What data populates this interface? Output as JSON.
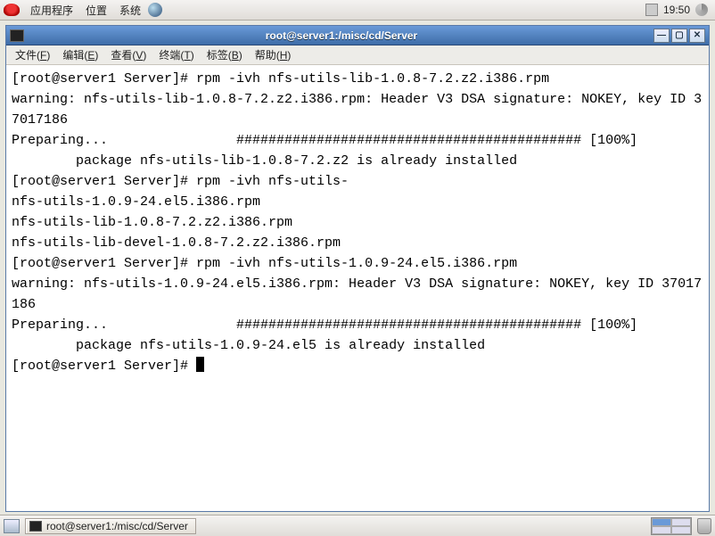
{
  "panel": {
    "menus": [
      "应用程序",
      "位置",
      "系统"
    ],
    "clock": "19:50"
  },
  "window": {
    "title": "root@server1:/misc/cd/Server",
    "menubar": [
      {
        "label": "文件",
        "key": "F"
      },
      {
        "label": "编辑",
        "key": "E"
      },
      {
        "label": "查看",
        "key": "V"
      },
      {
        "label": "终端",
        "key": "T"
      },
      {
        "label": "标签",
        "key": "B"
      },
      {
        "label": "帮助",
        "key": "H"
      }
    ]
  },
  "terminal_lines": [
    "[root@server1 Server]# rpm -ivh nfs-utils-lib-1.0.8-7.2.z2.i386.rpm",
    "warning: nfs-utils-lib-1.0.8-7.2.z2.i386.rpm: Header V3 DSA signature: NOKEY, key ID 37017186",
    "Preparing...                ########################################### [100%]",
    "        package nfs-utils-lib-1.0.8-7.2.z2 is already installed",
    "[root@server1 Server]# rpm -ivh nfs-utils-",
    "nfs-utils-1.0.9-24.el5.i386.rpm",
    "nfs-utils-lib-1.0.8-7.2.z2.i386.rpm",
    "nfs-utils-lib-devel-1.0.8-7.2.z2.i386.rpm",
    "[root@server1 Server]# rpm -ivh nfs-utils-1.0.9-24.el5.i386.rpm",
    "warning: nfs-utils-1.0.9-24.el5.i386.rpm: Header V3 DSA signature: NOKEY, key ID 37017186",
    "Preparing...                ########################################### [100%]",
    "        package nfs-utils-1.0.9-24.el5 is already installed"
  ],
  "terminal_prompt": "[root@server1 Server]# ",
  "taskbar": {
    "task_label": "root@server1:/misc/cd/Server"
  }
}
